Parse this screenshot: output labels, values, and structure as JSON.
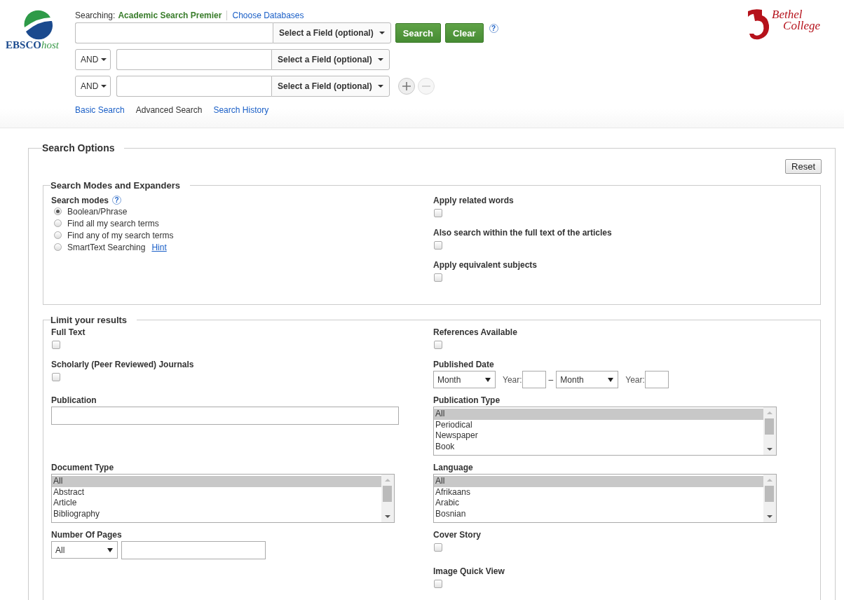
{
  "header": {
    "logo": {
      "brand": "EBSCO",
      "suffix": "host"
    },
    "searching_label": "Searching:",
    "database": "Academic Search Premier",
    "choose_link": "Choose Databases",
    "rows": [
      {
        "field": "Select a Field (optional)"
      },
      {
        "operator": "AND",
        "field": "Select a Field (optional)"
      },
      {
        "operator": "AND",
        "field": "Select a Field (optional)"
      }
    ],
    "search_button": "Search",
    "clear_button": "Clear",
    "help": "?",
    "links": [
      {
        "label": "Basic Search",
        "selected": false
      },
      {
        "label": "Advanced Search",
        "selected": true
      },
      {
        "label": "Search History",
        "selected": false
      }
    ],
    "institution_logo": {
      "line1": "Bethel",
      "line2": "College"
    }
  },
  "options": {
    "title": "Search Options",
    "reset": "Reset",
    "modes_section": {
      "title": "Search Modes and Expanders",
      "modes_label": "Search modes",
      "help": "?",
      "modes": [
        {
          "label": "Boolean/Phrase",
          "selected": true
        },
        {
          "label": "Find all my search terms",
          "selected": false
        },
        {
          "label": "Find any of my search terms",
          "selected": false
        },
        {
          "label": "SmartText Searching",
          "selected": false,
          "hint": "Hint"
        }
      ],
      "expanders": [
        {
          "label": "Apply related words",
          "checked": false
        },
        {
          "label": "Also search within the full text of the articles",
          "checked": false
        },
        {
          "label": "Apply equivalent subjects",
          "checked": false
        }
      ]
    },
    "limits_section": {
      "title": "Limit your results",
      "rows": [
        {
          "left": {
            "kind": "checkbox",
            "label": "Full Text",
            "checked": false
          },
          "right": {
            "kind": "checkbox",
            "label": "References Available",
            "checked": false
          }
        },
        {
          "left": {
            "kind": "checkbox",
            "label": "Scholarly (Peer Reviewed) Journals",
            "checked": false
          },
          "right": {
            "kind": "date",
            "label": "Published Date",
            "from_month": "Month",
            "from_year_label": "Year:",
            "dash": "–",
            "to_month": "Month",
            "to_year_label": "Year:"
          }
        },
        {
          "left": {
            "kind": "text",
            "label": "Publication"
          },
          "right": {
            "kind": "listbox",
            "label": "Publication Type",
            "items": [
              {
                "label": "All",
                "selected": true
              },
              {
                "label": "Periodical",
                "selected": false
              },
              {
                "label": "Newspaper",
                "selected": false
              },
              {
                "label": "Book",
                "selected": false
              }
            ]
          }
        },
        {
          "left": {
            "kind": "listbox",
            "label": "Document Type",
            "items": [
              {
                "label": "All",
                "selected": true
              },
              {
                "label": "Abstract",
                "selected": false
              },
              {
                "label": "Article",
                "selected": false
              },
              {
                "label": "Bibliography",
                "selected": false
              }
            ]
          },
          "right": {
            "kind": "listbox",
            "label": "Language",
            "items": [
              {
                "label": "All",
                "selected": true
              },
              {
                "label": "Afrikaans",
                "selected": false
              },
              {
                "label": "Arabic",
                "selected": false
              },
              {
                "label": "Bosnian",
                "selected": false
              }
            ]
          }
        },
        {
          "left": {
            "kind": "pages",
            "label": "Number Of Pages",
            "select": "All"
          },
          "right": {
            "kind": "checkbox",
            "label": "Cover Story",
            "checked": false
          }
        },
        {
          "right": {
            "kind": "checkbox",
            "label": "Image Quick View",
            "checked": false
          }
        }
      ]
    }
  }
}
